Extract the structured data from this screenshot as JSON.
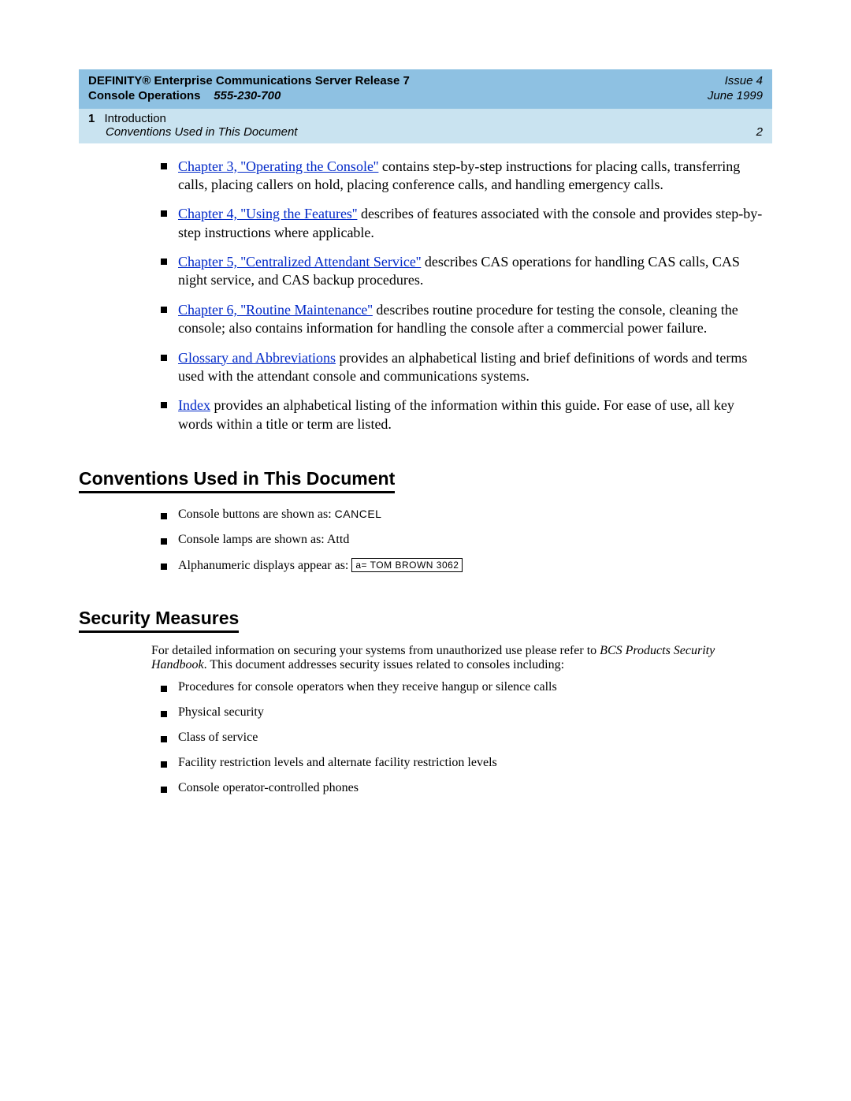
{
  "header": {
    "prod_line": "DEFINITY® Enterprise Communications Server Release 7",
    "section_bold": "Console Operations",
    "docnum": "555-230-700",
    "issue": "Issue 4",
    "date": "June 1999",
    "chap_num": "1",
    "chap_title": "Introduction",
    "running_sec": "Conventions Used in This Document",
    "page": "2"
  },
  "overview_items": [
    {
      "link": "Chapter 3, ''Operating the Console''",
      "rest": " contains step-by-step instructions for placing calls, transferring calls, placing callers on hold, placing conference calls, and handling emergency calls."
    },
    {
      "link": "Chapter 4, ''Using the Features''",
      "rest": " describes of features associated with the console and provides step-by-step instructions where applicable."
    },
    {
      "link": "Chapter 5, ''Centralized Attendant Service''",
      "rest": " describes CAS operations for handling CAS calls, CAS night service, and CAS backup procedures."
    },
    {
      "link": "Chapter 6, ''Routine Maintenance''",
      "rest": " describes routine procedure for testing the console, cleaning the console; also contains information for handling the console after a commercial power failure."
    },
    {
      "link": "Glossary and Abbreviations",
      "rest": " provides an alphabetical listing and brief definitions of words and terms used with the attendant console and communications systems."
    },
    {
      "link": "Index",
      "rest": " provides an alphabetical listing of the information within this guide. For ease of use, all key words within a title or term are listed."
    }
  ],
  "headings": {
    "conventions": "Conventions Used in This Document",
    "security": "Security Measures"
  },
  "conventions": {
    "b1_pre": "Console buttons are shown as: ",
    "b1_code": "CANCEL",
    "b2": "Console lamps are shown as: Attd",
    "b3_pre": "Alphanumeric displays appear as: ",
    "b3_box": "a=   TOM BROWN     3062"
  },
  "security": {
    "intro_pre": "For detailed information on securing your systems from unauthorized use please refer to ",
    "intro_em": "BCS Products Security Handbook",
    "intro_post": ". This document addresses security issues related to consoles including:",
    "items": [
      "Procedures for console operators when they receive hangup or silence calls",
      "Physical security",
      "Class of service",
      "Facility restriction levels and alternate facility restriction levels",
      "Console operator-controlled phones"
    ]
  }
}
